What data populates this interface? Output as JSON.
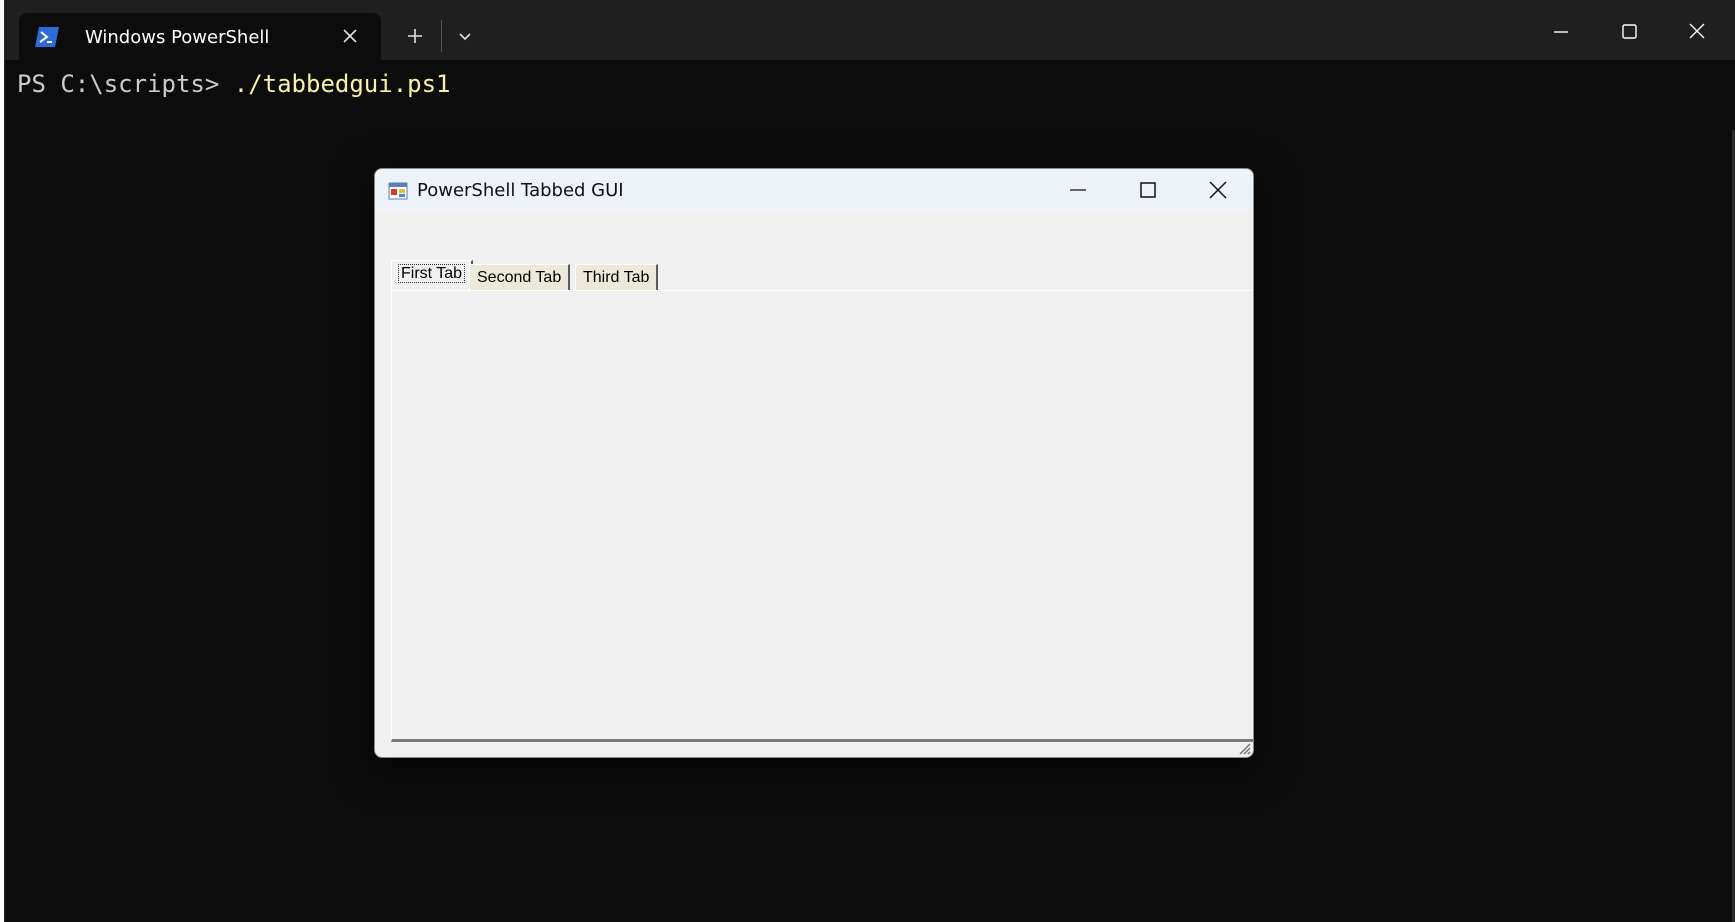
{
  "terminal": {
    "tab_title": "Windows PowerShell",
    "prompt": "PS C:\\scripts> ",
    "command": "./tabbedgui.ps1",
    "icons": {
      "app": "powershell-icon",
      "tab_close": "close-icon",
      "new_tab": "plus-icon",
      "dropdown": "chevron-down-icon",
      "minimize": "minimize-icon",
      "maximize": "maximize-icon",
      "close": "close-icon"
    },
    "colors": {
      "background": "#0c0c0c",
      "titlebar": "#1f1f1f",
      "command": "#f9f1a5"
    }
  },
  "dialog": {
    "title": "PowerShell Tabbed GUI",
    "tabs": [
      {
        "label": "First Tab",
        "selected": true
      },
      {
        "label": "Second Tab",
        "selected": false
      },
      {
        "label": "Third Tab",
        "selected": false
      }
    ],
    "icons": {
      "app": "form-app-icon",
      "minimize": "minimize-icon",
      "maximize": "maximize-icon",
      "close": "close-icon",
      "size_grip": "size-grip-icon"
    }
  }
}
